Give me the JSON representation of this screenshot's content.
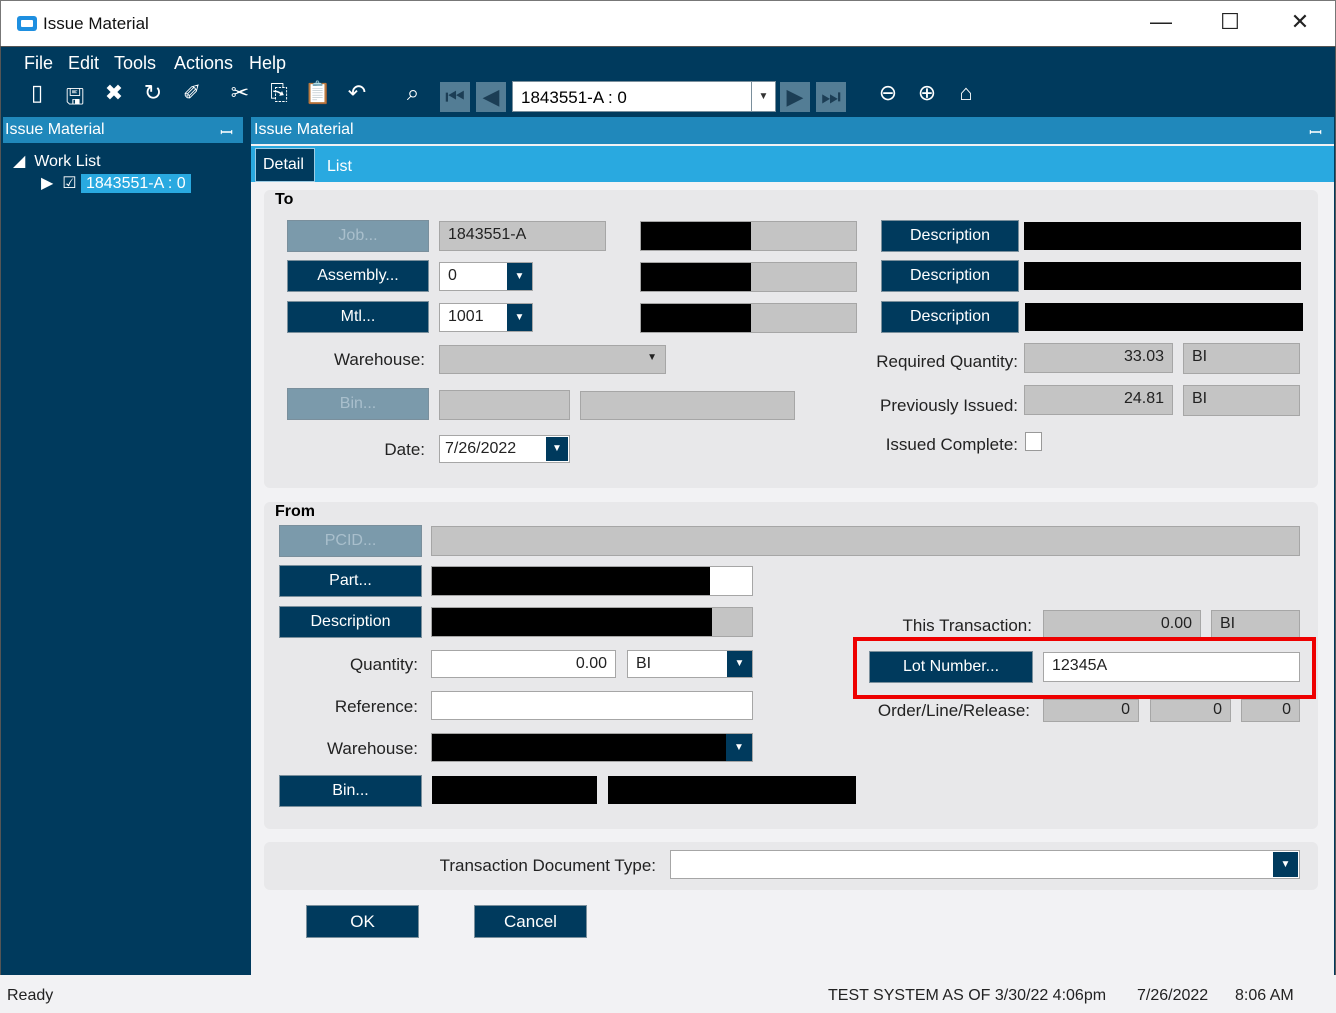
{
  "window": {
    "title": "Issue Material",
    "minimize": "—",
    "maximize": "☐",
    "close": "✕"
  },
  "menu": [
    "File",
    "Edit",
    "Tools",
    "Actions",
    "Help"
  ],
  "toolbar": {
    "record_combo": "1843551-A : 0",
    "icons": [
      "new-icon",
      "save-icon",
      "delete-icon",
      "refresh-icon",
      "clear-icon",
      "cut-icon",
      "copy-icon",
      "paste-icon",
      "undo-icon",
      "search-icon",
      "first-icon",
      "prev-icon",
      "next-icon",
      "last-icon",
      "back-icon",
      "forward-icon",
      "home-icon"
    ]
  },
  "left_panel": {
    "title": "Issue Material",
    "tree_root": "Work List",
    "tree_item": "1843551-A : 0"
  },
  "main_panel": {
    "title": "Issue Material",
    "tabs": [
      "Detail",
      "List"
    ]
  },
  "to": {
    "title": "To",
    "job_btn": "Job...",
    "job": "1843551-A",
    "assembly_btn": "Assembly...",
    "assembly": "0",
    "mtl_btn": "Mtl...",
    "mtl": "1001",
    "desc_btn": "Description",
    "warehouse_label": "Warehouse:",
    "bin_btn": "Bin...",
    "date_label": "Date:",
    "date": "7/26/2022",
    "req_qty_label": "Required Quantity:",
    "req_qty": "33.03",
    "req_uom": "BI",
    "prev_label": "Previously Issued:",
    "prev_qty": "24.81",
    "prev_uom": "BI",
    "complete_label": "Issued Complete:"
  },
  "from": {
    "title": "From",
    "pcid_btn": "PCID...",
    "part_btn": "Part...",
    "desc_btn": "Description",
    "qty_label": "Quantity:",
    "qty": "0.00",
    "qty_uom": "BI",
    "ref_label": "Reference:",
    "warehouse_label": "Warehouse:",
    "bin_btn": "Bin...",
    "trans_label": "This Transaction:",
    "trans_qty": "0.00",
    "trans_uom": "BI",
    "lot_btn": "Lot Number...",
    "lot": "12345A",
    "olr_label": "Order/Line/Release:",
    "order": "0",
    "line": "0",
    "release": "0"
  },
  "doc_type_label": "Transaction Document Type:",
  "ok": "OK",
  "cancel": "Cancel",
  "status": {
    "left": "Ready",
    "system": "TEST SYSTEM AS OF 3/30/22 4:06pm",
    "date": "7/26/2022",
    "time": "8:06 AM"
  }
}
